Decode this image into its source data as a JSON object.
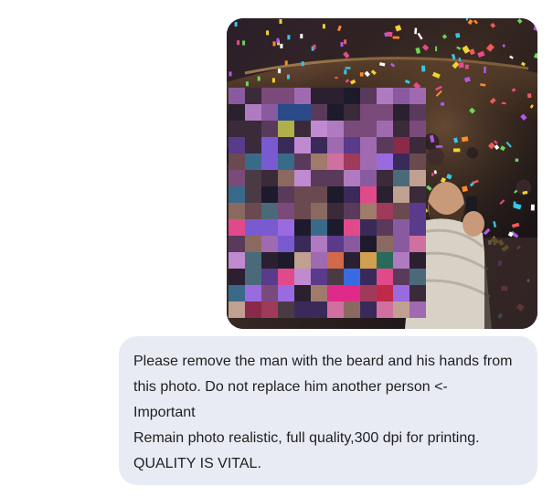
{
  "image_message": {
    "description_icon": "photo-attachment"
  },
  "text_message": {
    "lines": [
      "Please remove the man with the beard and his hands from",
      "this photo. Do not replace him another person <-",
      "Important",
      "Remain photo realistic, full quality,300 dpi for printing.",
      "QUALITY IS VITAL."
    ]
  },
  "colors": {
    "bubble_background": "#e8ebf3",
    "text": "#1f1f1f"
  }
}
